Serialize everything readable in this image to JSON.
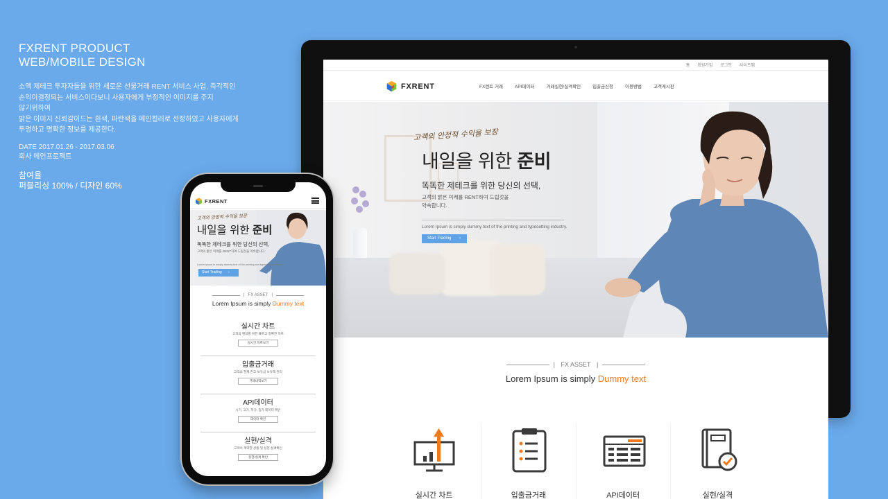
{
  "caption": {
    "title_line1": "FXRENT PRODUCT",
    "title_line2": "WEB/MOBILE DESIGN",
    "desc_line1": "소액 제테크 투자자들을 위한 새로운 선물거래 RENT 서비스 사업, 즉각적인",
    "desc_line2": "손익이결정되는 서비스이다보니 사용자에게 부정적인 이미지를 주지",
    "desc_line3": "않기위하여",
    "desc_line4": "밝은 이미지 신뢰감이드는 흰색, 파란색을 메인컬러로 선정하였고 사용자에게",
    "desc_line5": "투명하고 명확한 정보를 제공한다.",
    "date": "DATE  2017.01.26 - 2017.03.06",
    "client": "회사 메인프로젝트",
    "participation_label": "참여율",
    "participation_value": "퍼블리싱 100% / 디자인 60%"
  },
  "desktop": {
    "topbar": [
      "홈",
      "회원가입",
      "로그인",
      "사이트맵"
    ],
    "logo_text": "FXRENT",
    "menu": [
      "FX렌트 거래",
      "API데이터",
      "거래실현/실격확인",
      "입출금신청",
      "이용방법",
      "고객게시판"
    ],
    "hero": {
      "sub": "고객의 안정적 수익을 보장",
      "headline_light": "내일을 위한 ",
      "headline_bold": "준비",
      "lead": "똑똑한 제테크를 위한 당신의 선택,",
      "small_line1": "고객의 밝은 미래를 RENT하여 드립것을",
      "small_line2": "약속합니다.",
      "lorem": "Lorem Ipsum is simply dummy text of the printing and typesetting industry.",
      "button": "Start Trading"
    },
    "asset": {
      "label": "FX ASSET",
      "heading_prefix": "Lorem Ipsum is simply ",
      "heading_accent": "Dummy text"
    },
    "features": [
      "실시간 차트",
      "입출금거래",
      "API데이터",
      "실현/실격"
    ]
  },
  "mobile": {
    "logo_text": "FXRENT",
    "hero": {
      "sub": "고객의 안정적 수익을 보장",
      "headline_light": "내일을 위한 ",
      "headline_bold": "준비",
      "lead": "똑똑한 제테크를 위한 당신의 선택,",
      "small": "고객의 밝은 미래를 RENT하여 드립것을 약속합니다.",
      "lorem": "Lorem Ipsum is simply dummy text of the printing and typesetting industry.",
      "button": "Start Trading"
    },
    "asset": {
      "label": "FX ASSET",
      "heading_prefix": "Lorem Ipsum is simply ",
      "heading_accent": "Dummy text"
    },
    "items": [
      {
        "title": "실시간 차트",
        "desc": "고객의 편의를 위한 빠르고 정확한 차트",
        "button": "실시간 차트보기"
      },
      {
        "title": "입출금거래",
        "desc": "고객의 현재 잔고 보유금 보유액 관리",
        "button": "거래내역보기"
      },
      {
        "title": "API데이터",
        "desc": "시기, 고가, 저가, 종가 데이터 확인",
        "button": "데이터 확인"
      },
      {
        "title": "실현/실격",
        "desc": "고객이 계약한 상품 및 실현,실격확인",
        "button": "실현/실격 확인"
      }
    ]
  },
  "colors": {
    "background": "#6aa9ea",
    "accent_blue": "#5fa2e6",
    "accent_orange": "#f07b1e",
    "icon_dark": "#3a3a3a"
  },
  "icons": [
    "logo-cube-icon",
    "chart-growth-icon",
    "clipboard-list-icon",
    "data-window-icon",
    "notebook-check-icon",
    "chevron-right-icon",
    "hamburger-menu-icon"
  ]
}
